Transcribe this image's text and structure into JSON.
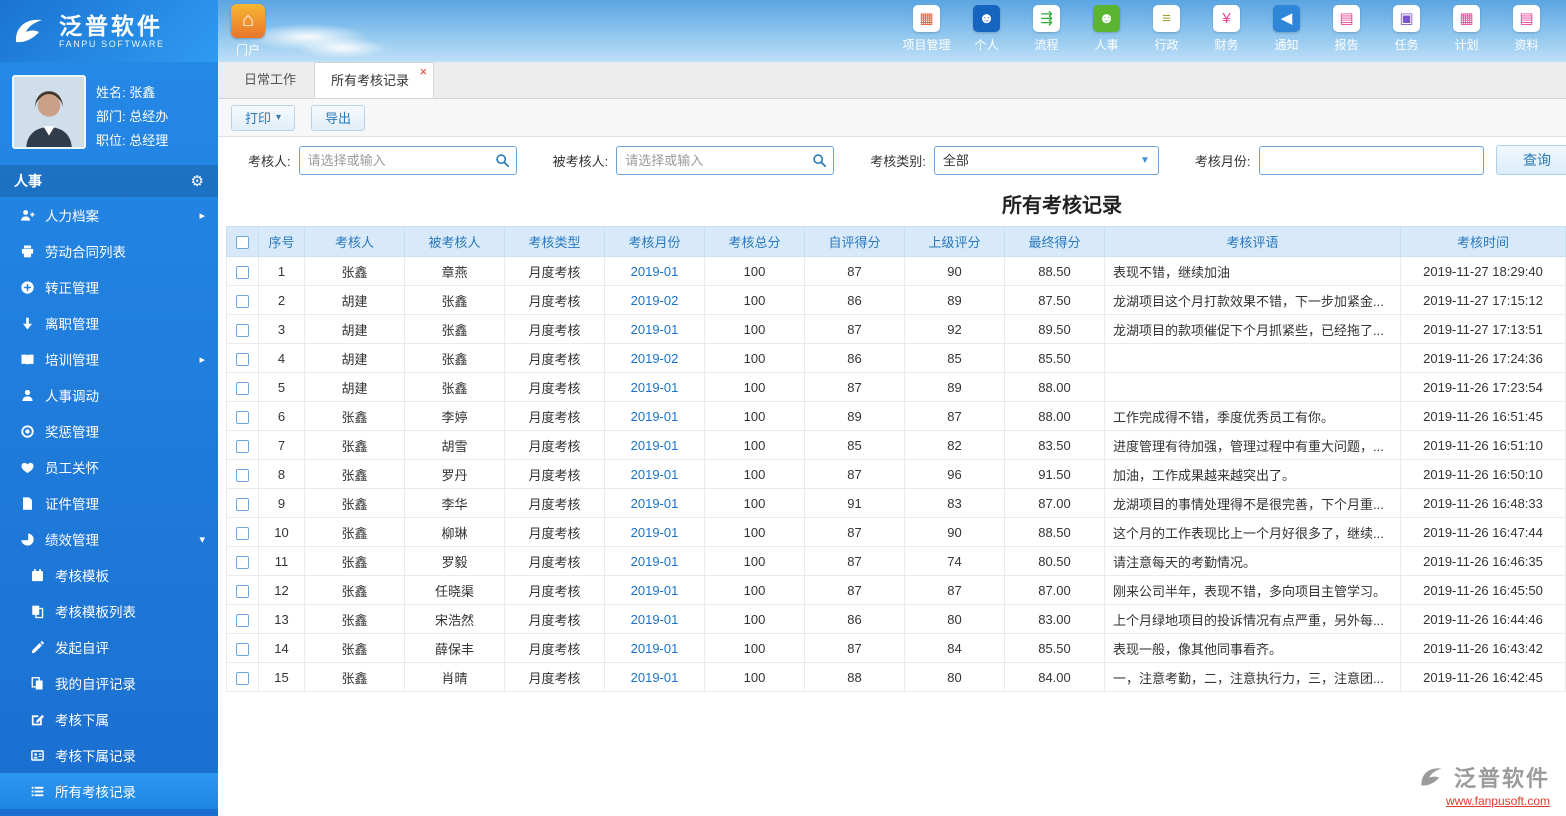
{
  "brand": {
    "name": "泛普软件",
    "subtitle": "FANPU SOFTWARE"
  },
  "portal": {
    "label": "门户"
  },
  "topnav": [
    {
      "label": "项目管理",
      "icon": "project-management-icon",
      "glyph": "▦",
      "fg": "#e2572b",
      "bg": "#ffffff"
    },
    {
      "label": "个人",
      "icon": "personal-icon",
      "glyph": "☻",
      "fg": "#ffffff",
      "bg": "#1565c0"
    },
    {
      "label": "流程",
      "icon": "workflow-icon",
      "glyph": "⇶",
      "fg": "#2eae3c",
      "bg": "#ffffff"
    },
    {
      "label": "人事",
      "icon": "hr-icon",
      "glyph": "☻",
      "fg": "#ffffff",
      "bg": "#5cb531"
    },
    {
      "label": "行政",
      "icon": "administration-icon",
      "glyph": "≡",
      "fg": "#a8a23c",
      "bg": "#ffffff"
    },
    {
      "label": "财务",
      "icon": "finance-icon",
      "glyph": "¥",
      "fg": "#e84393",
      "bg": "#ffffff"
    },
    {
      "label": "通知",
      "icon": "notification-icon",
      "glyph": "◀",
      "fg": "#ffffff",
      "bg": "#2f86d8"
    },
    {
      "label": "报告",
      "icon": "report-icon",
      "glyph": "▤",
      "fg": "#e84393",
      "bg": "#ffffff"
    },
    {
      "label": "任务",
      "icon": "task-icon",
      "glyph": "▣",
      "fg": "#7e57c2",
      "bg": "#ffffff"
    },
    {
      "label": "计划",
      "icon": "plan-icon",
      "glyph": "▦",
      "fg": "#e84393",
      "bg": "#ffffff"
    },
    {
      "label": "资料",
      "icon": "document-icon",
      "glyph": "▤",
      "fg": "#e84393",
      "bg": "#ffffff"
    },
    {
      "label": "",
      "icon": "clipped-nav-icon",
      "glyph": "▧",
      "fg": "#ffffff",
      "bg": "#27b3a2"
    }
  ],
  "profile": {
    "name": "姓名: 张鑫",
    "department": "部门: 总经办",
    "position": "职位: 总经理"
  },
  "sidebar": {
    "section": "人事",
    "items": [
      {
        "label": "人力档案"
      },
      {
        "label": "劳动合同列表"
      },
      {
        "label": "转正管理"
      },
      {
        "label": "离职管理"
      },
      {
        "label": "培训管理"
      },
      {
        "label": "人事调动"
      },
      {
        "label": "奖惩管理"
      },
      {
        "label": "员工关怀"
      },
      {
        "label": "证件管理"
      },
      {
        "label": "绩效管理"
      }
    ],
    "subitems": [
      {
        "label": "考核模板"
      },
      {
        "label": "考核模板列表"
      },
      {
        "label": "发起自评"
      },
      {
        "label": "我的自评记录"
      },
      {
        "label": "考核下属"
      },
      {
        "label": "考核下属记录"
      },
      {
        "label": "所有考核记录"
      }
    ]
  },
  "tabs": {
    "tab1": "日常工作",
    "tab2": "所有考核记录"
  },
  "toolbar": {
    "print": "打印",
    "export": "导出"
  },
  "filters": {
    "assessor_label": "考核人:",
    "assessor_placeholder": "请选择或输入",
    "assessee_label": "被考核人:",
    "assessee_placeholder": "请选择或输入",
    "category_label": "考核类别:",
    "category_value": "全部",
    "month_label": "考核月份:",
    "month_value": "",
    "search_label": "查询"
  },
  "table": {
    "title": "所有考核记录",
    "columns": [
      "序号",
      "考核人",
      "被考核人",
      "考核类型",
      "考核月份",
      "考核总分",
      "自评得分",
      "上级评分",
      "最终得分",
      "考核评语",
      "考核时间"
    ],
    "rows": [
      {
        "seq": 1,
        "assessor": "张鑫",
        "assessee": "章燕",
        "type": "月度考核",
        "month": "2019-01",
        "total": 100,
        "self_score": 87,
        "superior_score": 90,
        "final_score": "88.50",
        "comment": "表现不错，继续加油",
        "time": "2019-11-27 18:29:40"
      },
      {
        "seq": 2,
        "assessor": "胡建",
        "assessee": "张鑫",
        "type": "月度考核",
        "month": "2019-02",
        "total": 100,
        "self_score": 86,
        "superior_score": 89,
        "final_score": "87.50",
        "comment": "龙湖项目这个月打款效果不错，下一步加紧金...",
        "time": "2019-11-27 17:15:12"
      },
      {
        "seq": 3,
        "assessor": "胡建",
        "assessee": "张鑫",
        "type": "月度考核",
        "month": "2019-01",
        "total": 100,
        "self_score": 87,
        "superior_score": 92,
        "final_score": "89.50",
        "comment": "龙湖项目的款项催促下个月抓紧些，已经拖了...",
        "time": "2019-11-27 17:13:51"
      },
      {
        "seq": 4,
        "assessor": "胡建",
        "assessee": "张鑫",
        "type": "月度考核",
        "month": "2019-02",
        "total": 100,
        "self_score": 86,
        "superior_score": 85,
        "final_score": "85.50",
        "comment": "",
        "time": "2019-11-26 17:24:36"
      },
      {
        "seq": 5,
        "assessor": "胡建",
        "assessee": "张鑫",
        "type": "月度考核",
        "month": "2019-01",
        "total": 100,
        "self_score": 87,
        "superior_score": 89,
        "final_score": "88.00",
        "comment": "",
        "time": "2019-11-26 17:23:54"
      },
      {
        "seq": 6,
        "assessor": "张鑫",
        "assessee": "李婷",
        "type": "月度考核",
        "month": "2019-01",
        "total": 100,
        "self_score": 89,
        "superior_score": 87,
        "final_score": "88.00",
        "comment": "工作完成得不错，季度优秀员工有你。",
        "time": "2019-11-26 16:51:45"
      },
      {
        "seq": 7,
        "assessor": "张鑫",
        "assessee": "胡雪",
        "type": "月度考核",
        "month": "2019-01",
        "total": 100,
        "self_score": 85,
        "superior_score": 82,
        "final_score": "83.50",
        "comment": "进度管理有待加强，管理过程中有重大问题，...",
        "time": "2019-11-26 16:51:10"
      },
      {
        "seq": 8,
        "assessor": "张鑫",
        "assessee": "罗丹",
        "type": "月度考核",
        "month": "2019-01",
        "total": 100,
        "self_score": 87,
        "superior_score": 96,
        "final_score": "91.50",
        "comment": "加油，工作成果越来越突出了。",
        "time": "2019-11-26 16:50:10"
      },
      {
        "seq": 9,
        "assessor": "张鑫",
        "assessee": "李华",
        "type": "月度考核",
        "month": "2019-01",
        "total": 100,
        "self_score": 91,
        "superior_score": 83,
        "final_score": "87.00",
        "comment": "龙湖项目的事情处理得不是很完善，下个月重...",
        "time": "2019-11-26 16:48:33"
      },
      {
        "seq": 10,
        "assessor": "张鑫",
        "assessee": "柳琳",
        "type": "月度考核",
        "month": "2019-01",
        "total": 100,
        "self_score": 87,
        "superior_score": 90,
        "final_score": "88.50",
        "comment": "这个月的工作表现比上一个月好很多了，继续...",
        "time": "2019-11-26 16:47:44"
      },
      {
        "seq": 11,
        "assessor": "张鑫",
        "assessee": "罗毅",
        "type": "月度考核",
        "month": "2019-01",
        "total": 100,
        "self_score": 87,
        "superior_score": 74,
        "final_score": "80.50",
        "comment": "请注意每天的考勤情况。",
        "time": "2019-11-26 16:46:35"
      },
      {
        "seq": 12,
        "assessor": "张鑫",
        "assessee": "任晓渠",
        "type": "月度考核",
        "month": "2019-01",
        "total": 100,
        "self_score": 87,
        "superior_score": 87,
        "final_score": "87.00",
        "comment": "刚来公司半年，表现不错，多向项目主管学习。",
        "time": "2019-11-26 16:45:50"
      },
      {
        "seq": 13,
        "assessor": "张鑫",
        "assessee": "宋浩然",
        "type": "月度考核",
        "month": "2019-01",
        "total": 100,
        "self_score": 86,
        "superior_score": 80,
        "final_score": "83.00",
        "comment": "上个月绿地项目的投诉情况有点严重，另外每...",
        "time": "2019-11-26 16:44:46"
      },
      {
        "seq": 14,
        "assessor": "张鑫",
        "assessee": "薛保丰",
        "type": "月度考核",
        "month": "2019-01",
        "total": 100,
        "self_score": 87,
        "superior_score": 84,
        "final_score": "85.50",
        "comment": "表现一般，像其他同事看齐。",
        "time": "2019-11-26 16:43:42"
      },
      {
        "seq": 15,
        "assessor": "张鑫",
        "assessee": "肖晴",
        "type": "月度考核",
        "month": "2019-01",
        "total": 100,
        "self_score": 88,
        "superior_score": 80,
        "final_score": "84.00",
        "comment": "一，注意考勤，二，注意执行力，三，注意团...",
        "time": "2019-11-26 16:42:45"
      }
    ]
  },
  "watermark": {
    "name": "泛普软件",
    "url": "www.fanpusoft.com"
  }
}
